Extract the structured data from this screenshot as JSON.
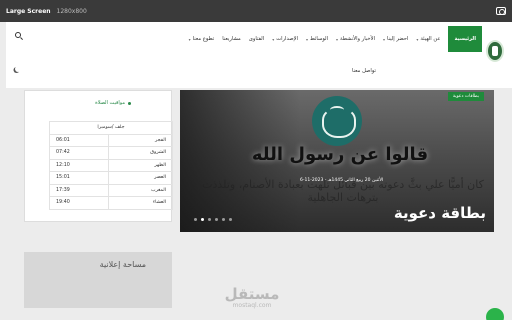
{
  "browser": {
    "title": "Large Screen",
    "dims": "1280x800"
  },
  "nav": {
    "items": [
      {
        "label": "الرئيسية",
        "caret": false
      },
      {
        "label": "عن الهيئة",
        "caret": true
      },
      {
        "label": "احضر إلينا",
        "caret": true
      },
      {
        "label": "الأخبار والأنشطة",
        "caret": true
      },
      {
        "label": "الوسائط",
        "caret": true
      },
      {
        "label": "الإصدارات",
        "caret": true
      },
      {
        "label": "الفتاوى",
        "caret": false
      },
      {
        "label": "مشاريعنا",
        "caret": false
      },
      {
        "label": "تطوع معنا",
        "caret": true
      }
    ],
    "second_row": "تواصل معنا"
  },
  "prayer_widget": {
    "title": "مواقيت الصلاة",
    "city": "جلف /سومبرا",
    "rows": [
      {
        "name": "الفجر",
        "time": "06:01"
      },
      {
        "name": "الشروق",
        "time": "07:42"
      },
      {
        "name": "الظهر",
        "time": "12:10"
      },
      {
        "name": "العصر",
        "time": "15:01"
      },
      {
        "name": "المغرب",
        "time": "17:39"
      },
      {
        "name": "العشاء",
        "time": "19:40"
      }
    ]
  },
  "ad": {
    "label": "مساحة إعلانية"
  },
  "hero": {
    "badge": "بطاقات دعوية",
    "headline": "قالوا عن رسول الله",
    "subtext": "كان أميًّا علي بثَّ دعوته بين قبائل تلهت بعبادة الأصنام، وتلذذت بترهات الجاهلية",
    "date": "الأثنين 20 ربيع الثاني 1445هـ - 2023-11-6",
    "title": "بطاقة دعوية",
    "dots": 6,
    "active_dot": 1
  },
  "watermark": {
    "arabic": "مستقل",
    "latin": "mostaql.com"
  },
  "colors": {
    "brand_green": "#1f8b3b",
    "topbar": "#3a3a3a",
    "ad_gray": "#d7d7d7"
  },
  "icons": [
    "camera-icon",
    "logo-emblem",
    "search-icon",
    "moon-icon",
    "whatsapp-icon"
  ]
}
